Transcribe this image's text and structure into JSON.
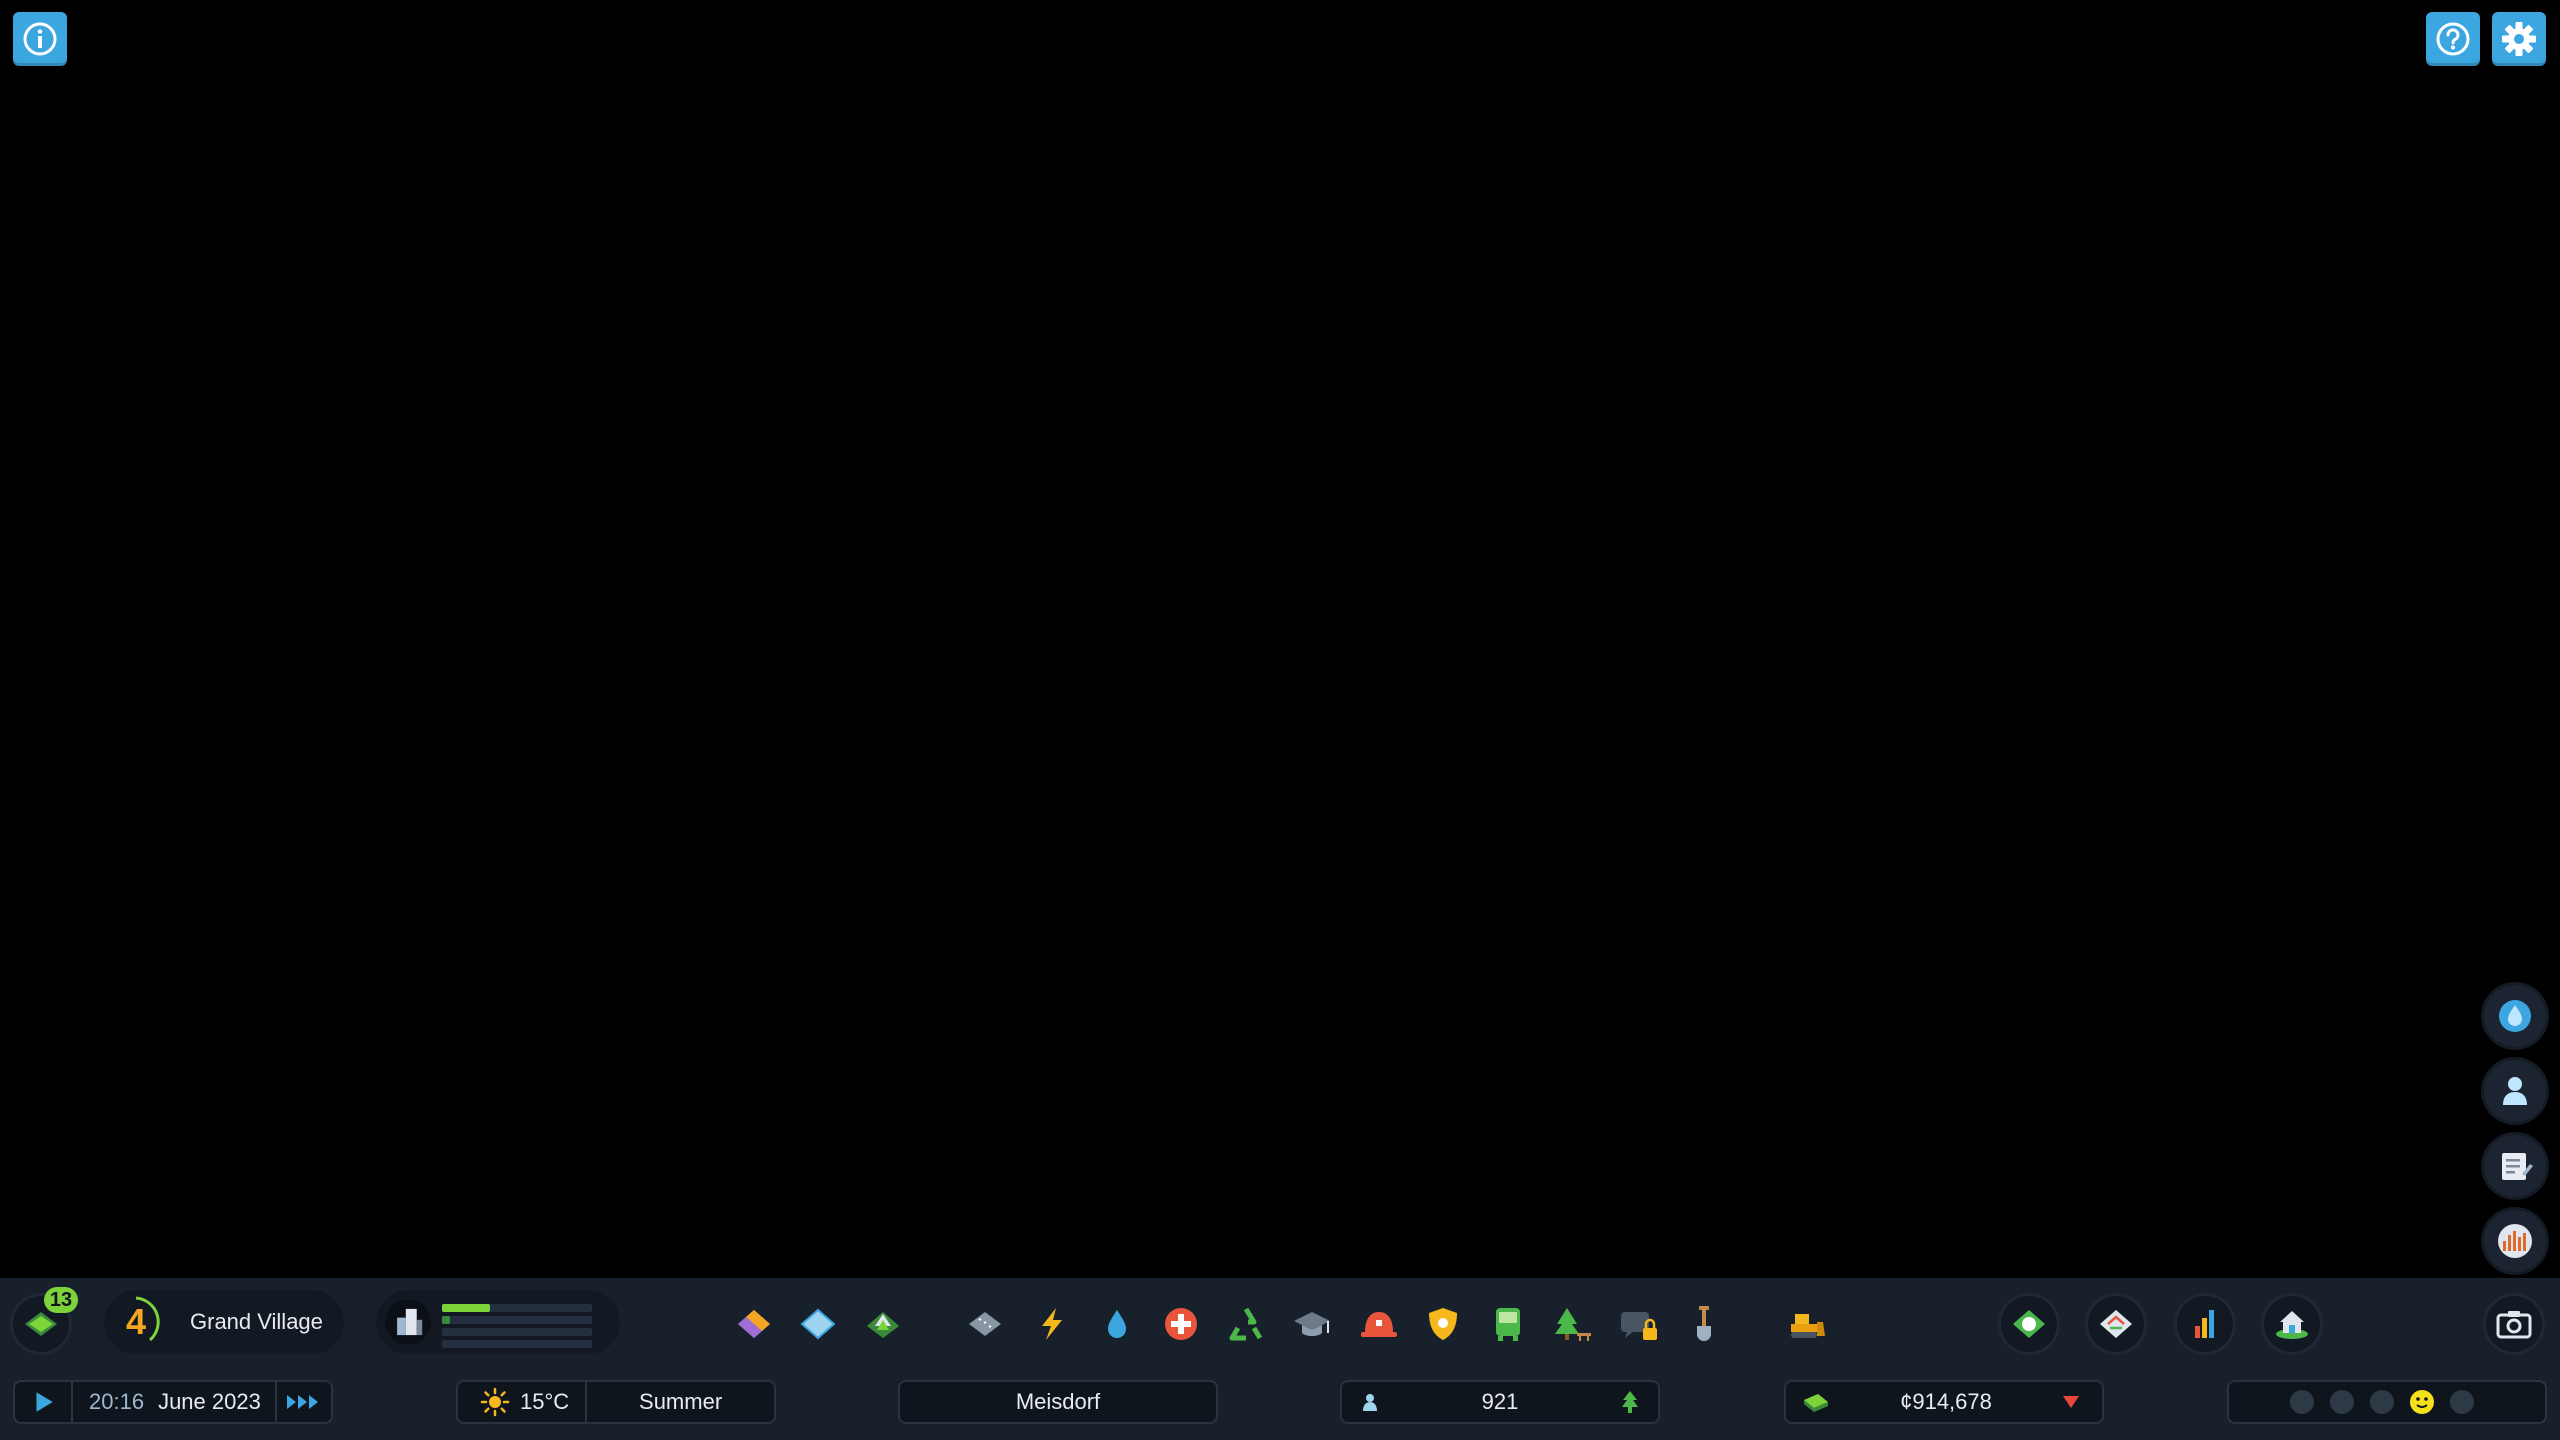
{
  "top_left": {
    "info_icon": "info-icon"
  },
  "top_right": {
    "help_icon": "help-icon",
    "settings_icon": "gear-icon"
  },
  "side_panel": [
    "water-drop-icon",
    "citizen-icon",
    "notes-icon",
    "radio-icon"
  ],
  "toolbar": {
    "notification_count": "13",
    "milestone_level": "4",
    "milestone_name": "Grand Village",
    "progress": {
      "primary_fraction": 0.32,
      "secondary_fraction": 0.05
    },
    "tools": [
      "zoning-icon",
      "area-icon",
      "landscaping-icon",
      "roads-icon",
      "electricity-icon",
      "water-icon",
      "healthcare-icon",
      "garbage-icon",
      "education-icon",
      "fire-icon",
      "police-icon",
      "transportation-icon",
      "parks-icon",
      "communications-locked-icon",
      "landscaping-shovel-icon",
      "bulldozer-icon"
    ],
    "right_tools": [
      "city-services-icon",
      "map-tiles-icon",
      "statistics-icon",
      "housing-icon"
    ],
    "camera_icon": "camera-icon"
  },
  "status": {
    "time": "20:16",
    "date": "June 2023",
    "temperature": "15°C",
    "season": "Summer",
    "city_name": "Meisdorf",
    "population": "921",
    "money": "¢914,678",
    "happiness_selected": "content"
  },
  "colors": {
    "accent_blue": "#3ba6e0",
    "toolbar_bg": "#18202b",
    "green": "#7cd43a",
    "money_down": "#e8463a"
  }
}
